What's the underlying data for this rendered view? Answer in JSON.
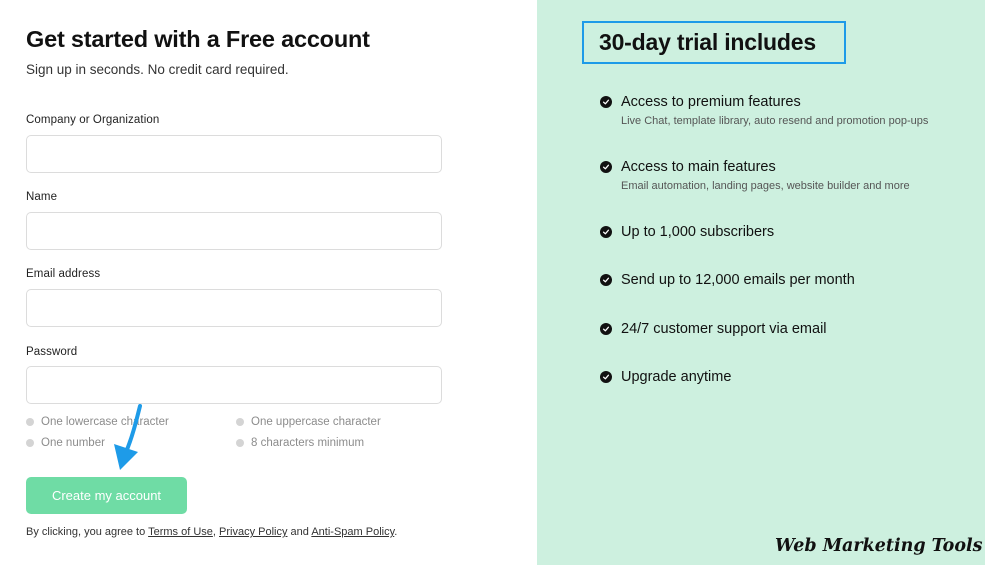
{
  "signup": {
    "title": "Get started with a Free account",
    "subtitle": "Sign up in seconds. No credit card required.",
    "fields": {
      "company": {
        "label": "Company or Organization",
        "value": ""
      },
      "name": {
        "label": "Name",
        "value": ""
      },
      "email": {
        "label": "Email address",
        "value": ""
      },
      "password": {
        "label": "Password",
        "value": ""
      }
    },
    "password_requirements": [
      "One lowercase character",
      "One uppercase character",
      "One number",
      "8 characters minimum"
    ],
    "create_button": "Create my account",
    "legal": {
      "prefix": "By clicking, you agree to ",
      "terms": "Terms of Use",
      "sep1": ", ",
      "privacy": "Privacy Policy",
      "sep2": " and ",
      "antispam": "Anti-Spam Policy",
      "suffix": "."
    }
  },
  "trial": {
    "title": "30-day trial includes",
    "features": [
      {
        "title": "Access to premium features",
        "subtitle": "Live Chat, template library, auto resend and promotion pop-ups"
      },
      {
        "title": "Access to main features",
        "subtitle": "Email automation, landing pages, website builder and more"
      },
      {
        "title": "Up to 1,000 subscribers"
      },
      {
        "title": "Send up to 12,000 emails per month"
      },
      {
        "title": "24/7 customer support via email"
      },
      {
        "title": "Upgrade anytime"
      }
    ]
  },
  "watermark": "Web Marketing Tools",
  "colors": {
    "panel_background": "#cdf0df",
    "button_background": "#6fdca5",
    "highlight_border": "#1e9be8",
    "arrow": "#1e9be8"
  },
  "icons": {
    "feature_bullet": "check-circle-icon",
    "annotation": "arrow-down-icon"
  }
}
